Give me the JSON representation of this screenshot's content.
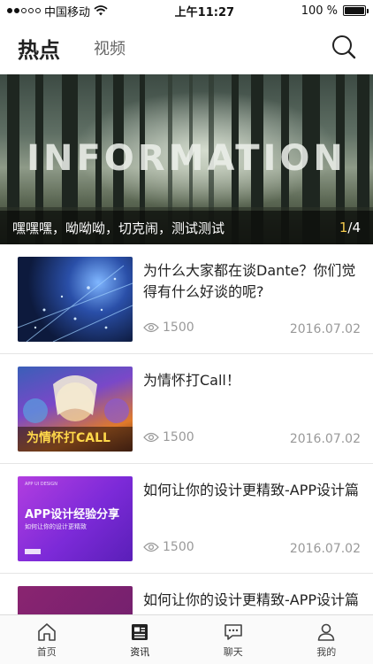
{
  "status_bar": {
    "carrier": "中国移动",
    "time": "上午11:27",
    "battery_text": "100 %",
    "battery_level": 1.0
  },
  "header": {
    "tabs": [
      {
        "label": "热点",
        "active": true
      },
      {
        "label": "视频",
        "active": false
      }
    ],
    "search_icon": "search-icon"
  },
  "banner": {
    "image_text": "INFORMATION",
    "caption": "嘿嘿嘿，呦呦呦，切克闹，测试测试",
    "page_current": "1",
    "page_total": "/4",
    "accent_color": "#f2c94c"
  },
  "news": [
    {
      "title": "为什么大家都在谈Dante？你们觉得有什么好谈的呢?",
      "views": "1500",
      "date": "2016.07.02",
      "thumb": "city"
    },
    {
      "title": "为情怀打Call！",
      "views": "1500",
      "date": "2016.07.02",
      "thumb": "game",
      "thumb_text": "为情怀打CALL"
    },
    {
      "title": "如何让你的设计更精致-APP设计篇",
      "views": "1500",
      "date": "2016.07.02",
      "thumb": "purple",
      "thumb_text": "APP设计经验分享",
      "thumb_subtext": "如何让你的设计更精致",
      "thumb_header": "APP UI DESIGN"
    },
    {
      "title": "如何让你的设计更精致-APP设计篇",
      "views": "",
      "date": "",
      "thumb": "purple2"
    }
  ],
  "bottom_nav": [
    {
      "label": "首页",
      "icon": "home-icon",
      "active": false
    },
    {
      "label": "资讯",
      "icon": "news-icon",
      "active": true
    },
    {
      "label": "聊天",
      "icon": "chat-icon",
      "active": false
    },
    {
      "label": "我的",
      "icon": "profile-icon",
      "active": false
    }
  ]
}
